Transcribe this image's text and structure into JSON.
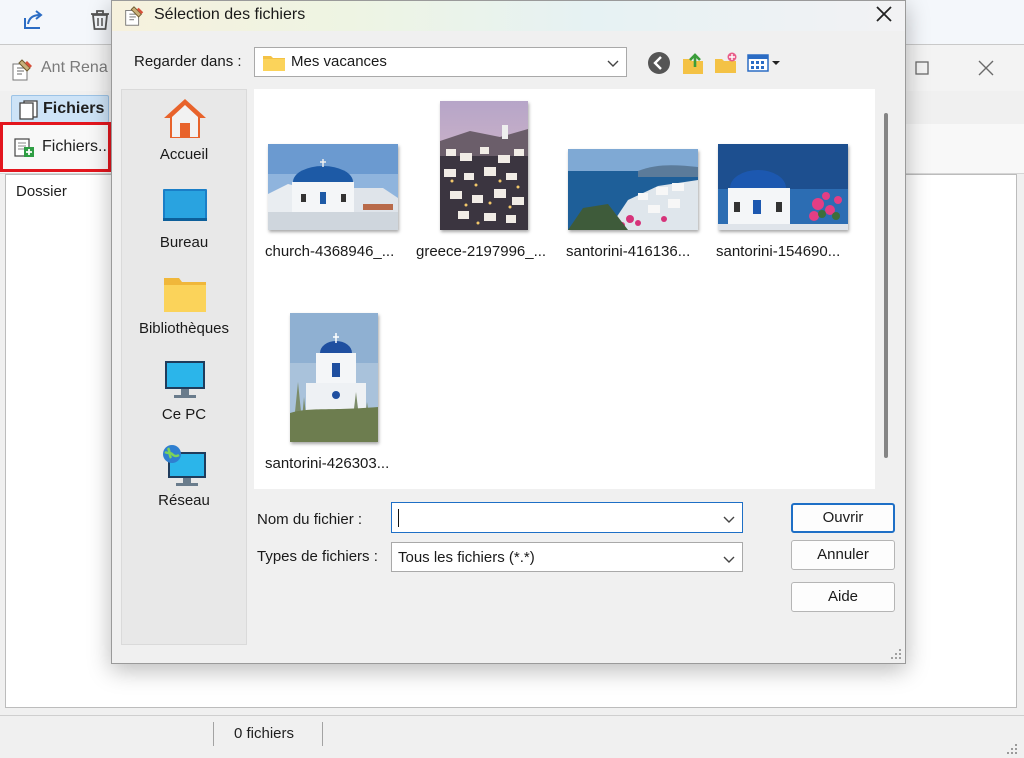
{
  "app": {
    "title": "Ant Rena",
    "tab_label": "Fichiers",
    "add_files_label": "Fichiers...",
    "column_header": "Dossier",
    "status_count": "0 fichiers"
  },
  "dialog": {
    "title": "Sélection des fichiers",
    "look_in_label": "Regarder dans :",
    "look_in_value": "Mes vacances",
    "places": [
      {
        "label": "Accueil",
        "icon": "home-icon"
      },
      {
        "label": "Bureau",
        "icon": "desktop-icon"
      },
      {
        "label": "Bibliothèques",
        "icon": "libraries-icon"
      },
      {
        "label": "Ce PC",
        "icon": "computer-icon"
      },
      {
        "label": "Réseau",
        "icon": "network-icon"
      }
    ],
    "files": [
      {
        "label": "church-4368946_..."
      },
      {
        "label": "greece-2197996_..."
      },
      {
        "label": "santorini-416136..."
      },
      {
        "label": "santorini-154690..."
      },
      {
        "label": "santorini-426303..."
      }
    ],
    "filename_label": "Nom du fichier :",
    "filename_value": "",
    "filetype_label": "Types de fichiers :",
    "filetype_value": "Tous les fichiers (*.*)",
    "open_button": "Ouvrir",
    "cancel_button": "Annuler",
    "help_button": "Aide"
  },
  "colors": {
    "accent": "#1e6fc6",
    "highlight_box": "#e3161e",
    "tab_background": "#cde3f7"
  }
}
